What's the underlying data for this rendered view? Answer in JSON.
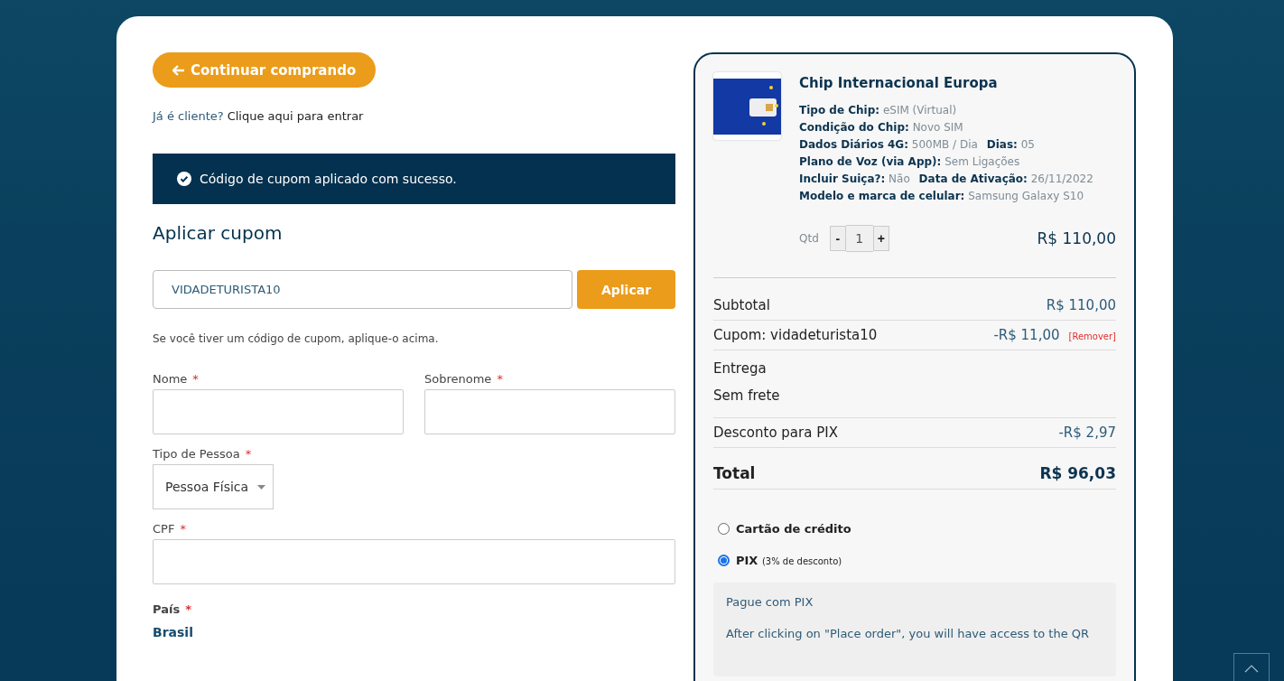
{
  "continue_button": {
    "label": "Continuar comprando"
  },
  "login_prompt": {
    "text": "Já é cliente?",
    "link": "Clique aqui para entrar"
  },
  "notice": {
    "text": "Código de cupom aplicado com sucesso."
  },
  "coupon": {
    "heading": "Aplicar cupom",
    "value": "VIDADETURISTA10",
    "button": "Aplicar",
    "hint": "Se você tiver um código de cupom, aplique-o acima."
  },
  "form": {
    "fields": [
      {
        "kind": "half",
        "label": "Nome",
        "required_mark": "*"
      },
      {
        "kind": "half",
        "label": "Sobrenome",
        "required_mark": "*"
      },
      {
        "kind": "select",
        "label": "Tipo de Pessoa",
        "required_mark": "*",
        "value": "Pessoa Física"
      },
      {
        "kind": "full",
        "label": "CPF",
        "required_mark": "*"
      },
      {
        "kind": "static",
        "label": "País",
        "required_mark": "*",
        "value": "Brasil"
      }
    ]
  },
  "order": {
    "product": {
      "name": "Chip Internacional Europa",
      "attributes": [
        {
          "label": "Tipo de Chip:",
          "value": "eSIM (Virtual)"
        },
        {
          "label": "Condição do Chip:",
          "value": "Novo SIM"
        },
        {
          "label": "Dados Diários 4G:",
          "value": "500MB / Dia"
        },
        {
          "label": "Dias:",
          "value": "05"
        },
        {
          "label": "Plano de Voz (via App):",
          "value": "Sem Ligações"
        },
        {
          "label": "Incluir Suiça?:",
          "value": "Não"
        },
        {
          "label": "Data de Ativação:",
          "value": "26/11/2022"
        },
        {
          "label": "Modelo e marca de celular:",
          "value": "Samsung Galaxy S10"
        }
      ],
      "quantity_label": "Qtd",
      "minus": "-",
      "quantity": "1",
      "plus": "+",
      "price": "R$ 110,00"
    },
    "totals": [
      {
        "kind": "row",
        "label": "Subtotal",
        "value": "R$ 110,00"
      },
      {
        "kind": "coupon",
        "label": "Cupom: vidadeturista10",
        "value": "-R$ 11,00",
        "link": "[Remover]"
      },
      {
        "kind": "shipping",
        "label": "Entrega",
        "value": "Sem frete"
      },
      {
        "kind": "row",
        "label": "Desconto para PIX",
        "value": "-R$ 2,97"
      },
      {
        "kind": "total",
        "label": "Total",
        "value": "R$ 96,03"
      }
    ],
    "payment_methods": [
      {
        "label": "Cartão de crédito",
        "selected": false
      },
      {
        "label": "PIX",
        "note": "(3% de desconto)",
        "selected": true
      }
    ],
    "pix_box": {
      "title": "Pague com PIX",
      "text": "After clicking on \"Place order\", you will have access to the QR"
    }
  }
}
